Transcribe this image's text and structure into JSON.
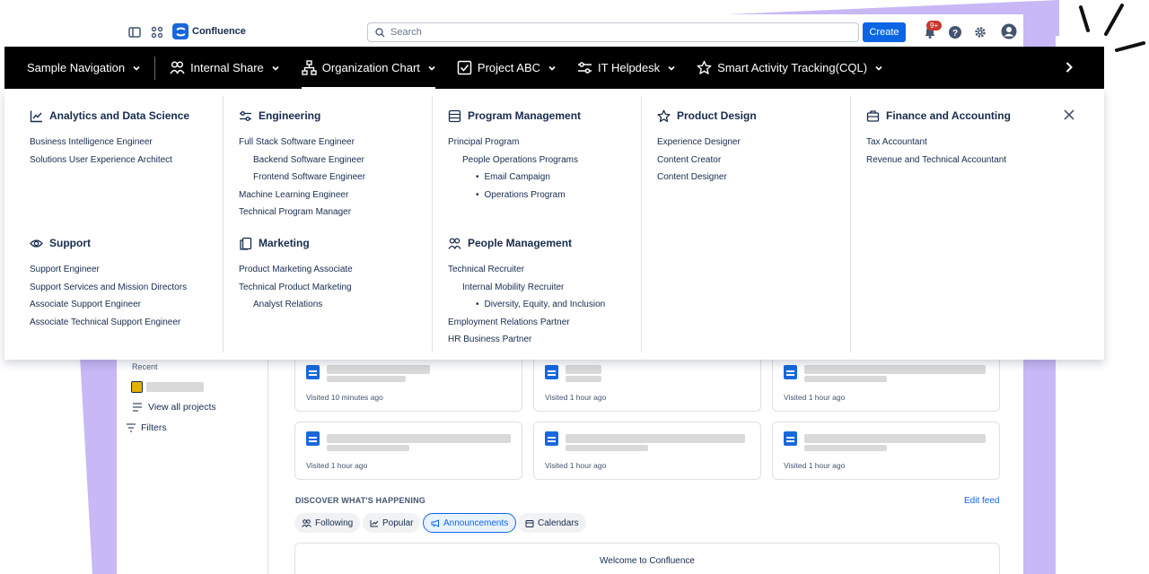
{
  "topbar": {
    "app_name": "Confluence",
    "search_placeholder": "Search",
    "create_label": "Create",
    "notifications_badge": "9+"
  },
  "nav": {
    "items": [
      {
        "label": "Sample Navigation",
        "icon": "none"
      },
      {
        "label": "Internal Share",
        "icon": "people-icon"
      },
      {
        "label": "Organization Chart",
        "icon": "org-chart-icon",
        "active": true
      },
      {
        "label": "Project ABC",
        "icon": "checkbox-icon"
      },
      {
        "label": "IT Helpdesk",
        "icon": "sliders-icon"
      },
      {
        "label": "Smart Activity Tracking(CQL)",
        "icon": "star-icon"
      }
    ]
  },
  "menu": {
    "analytics": {
      "title": "Analytics and Data Science",
      "links": [
        "Business Intelligence Engineer",
        "Solutions User Experience Architect"
      ]
    },
    "engineering": {
      "title": "Engineering",
      "links": [
        "Full Stack Software Engineer",
        "Backend Software Engineer",
        "Frontend Software Engineer",
        "Machine Learning Engineer",
        "Technical Program Manager"
      ]
    },
    "program_management": {
      "title": "Program Management",
      "links": [
        "Principal Program",
        "People Operations Programs",
        "Email Campaign",
        "Operations Program"
      ]
    },
    "product_design": {
      "title": "Product Design",
      "links": [
        "Experience Designer",
        "Content Creator",
        "Content Designer"
      ]
    },
    "finance": {
      "title": "Finance and Accounting",
      "links": [
        "Tax Accountant",
        "Revenue and Technical Accountant"
      ]
    },
    "support": {
      "title": "Support",
      "links": [
        "Support Engineer",
        "Support Services and Mission Directors",
        "Associate Support Engineer",
        "Associate Technical Support Engineer"
      ]
    },
    "marketing": {
      "title": "Marketing",
      "links": [
        "Product Marketing Associate",
        "Technical Product Marketing",
        "Analyst Relations"
      ]
    },
    "people_management": {
      "title": "People Management",
      "links": [
        "Technical Recruiter",
        "Internal Mobility Recruiter",
        "Diversity, Equity, and Inclusion",
        "Employment Relations Partner",
        "HR Business Partner"
      ]
    }
  },
  "sidebar": {
    "recent_label": "Recent",
    "view_all_projects": "View all projects",
    "filters": "Filters"
  },
  "cards": [
    {
      "visited": "Visited 10 minutes ago"
    },
    {
      "visited": "Visited 1 hour ago"
    },
    {
      "visited": "Visited 1 hour ago"
    },
    {
      "visited": "Visited 1 hour ago"
    },
    {
      "visited": "Visited 1 hour ago"
    },
    {
      "visited": "Visited 1 hour ago"
    }
  ],
  "feed": {
    "heading": "DISCOVER WHAT'S HAPPENING",
    "edit_feed": "Edit feed",
    "tabs": [
      "Following",
      "Popular",
      "Announcements",
      "Calendars"
    ],
    "active_tab": "Announcements",
    "welcome": "Welcome to Confluence"
  },
  "colors": {
    "accent": "#0c66e4",
    "navbar": "#000000",
    "decor_purple": "#c8b8f5",
    "badge": "#c9372c"
  }
}
